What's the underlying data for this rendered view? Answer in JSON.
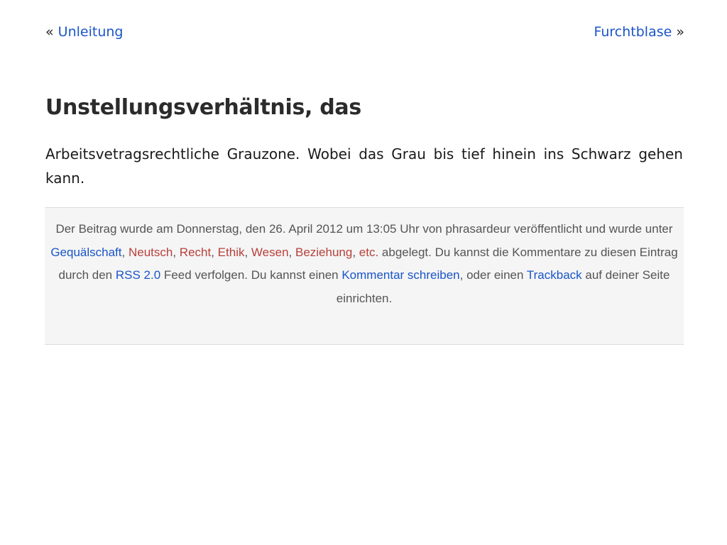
{
  "nav": {
    "prev_arrow": "«",
    "prev_label": "Unleitung",
    "next_label": "Furchtblase",
    "next_arrow": "»"
  },
  "post": {
    "title": "Unstellungsverhältnis, das",
    "excerpt": "Arbeitsvetragsrechtliche Grauzone. Wobei das Grau bis tief hinein ins Schwarz gehen kann."
  },
  "meta": {
    "text_1": "Der Beitrag wurde am Donnerstag, den 26. April 2012 um 13:05 Uhr von phrasardeur veröffentlicht und wurde unter ",
    "categories": [
      "Gequälschaft",
      "Neutsch",
      "Recht",
      "Ethik",
      "Wesen",
      "Beziehung",
      "etc."
    ],
    "sep": ", ",
    "text_2": " abgelegt. Du kannst die Kommentare zu diesen Eintrag durch den ",
    "rss_label": "RSS 2.0",
    "text_3": " Feed verfolgen. Du kannst einen ",
    "comment_label": "Kommentar schreiben",
    "text_4": ", oder einen ",
    "trackback_label": "Trackback",
    "text_5": " auf deiner Seite einrichten."
  },
  "colors": {
    "link_blue": "#1a55c8",
    "tag_red": "#b8403a",
    "meta_background": "#f5f5f5"
  }
}
